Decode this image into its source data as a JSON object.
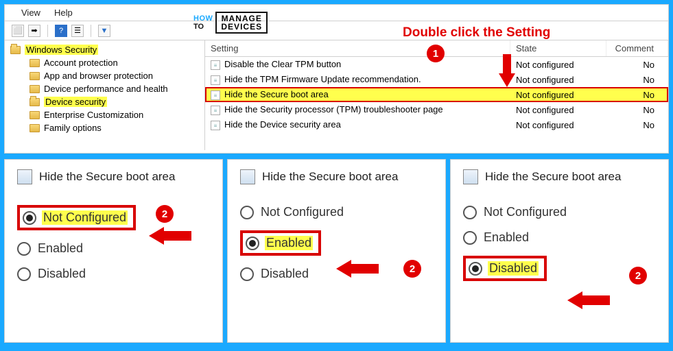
{
  "menu": {
    "view": "View",
    "help": "Help"
  },
  "annotation": {
    "title": "Double click the Setting",
    "badge1": "1",
    "badge2": "2"
  },
  "logo": {
    "how": "HOW",
    "to": "TO",
    "line1": "MANAGE",
    "line2": "DEVICES"
  },
  "tree": {
    "root": "Windows Security",
    "items": [
      "Account protection",
      "App and browser protection",
      "Device performance and health",
      "Device security",
      "Enterprise Customization",
      "Family options"
    ]
  },
  "list": {
    "headers": {
      "setting": "Setting",
      "state": "State",
      "comment": "Comment"
    },
    "rows": [
      {
        "name": "Disable the Clear TPM button",
        "state": "Not configured",
        "comment": "No"
      },
      {
        "name": "Hide the TPM Firmware Update recommendation.",
        "state": "Not configured",
        "comment": "No"
      },
      {
        "name": "Hide the Secure boot area",
        "state": "Not configured",
        "comment": "No"
      },
      {
        "name": "Hide the Security processor (TPM) troubleshooter page",
        "state": "Not configured",
        "comment": "No"
      },
      {
        "name": "Hide the Device security area",
        "state": "Not configured",
        "comment": "No"
      }
    ]
  },
  "dialog": {
    "title": "Hide the Secure boot area",
    "opts": {
      "nc": "Not Configured",
      "en": "Enabled",
      "dis": "Disabled"
    }
  }
}
